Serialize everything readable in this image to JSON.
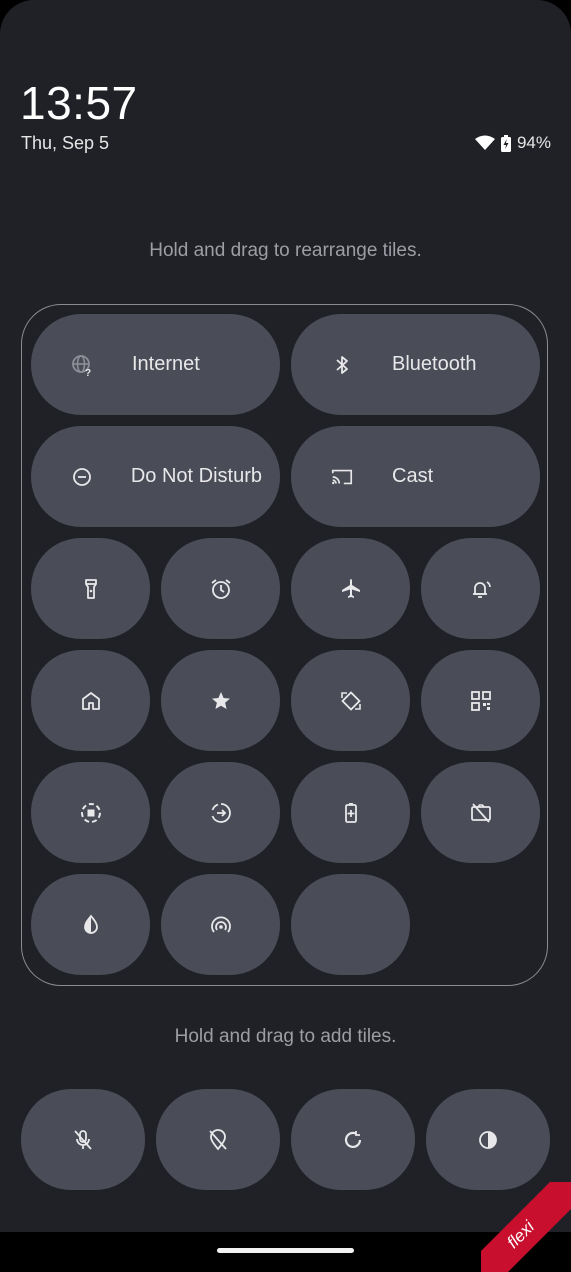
{
  "status_bar": {
    "time": "13:57",
    "date": "Thu, Sep 5",
    "battery": "94%"
  },
  "hints": {
    "rearrange": "Hold and drag to rearrange tiles.",
    "add": "Hold and drag to add tiles."
  },
  "active_tiles": [
    {
      "label": "Internet",
      "icon": "internet-icon"
    },
    {
      "label": "Bluetooth",
      "icon": "bluetooth-icon"
    },
    {
      "label": "Do Not Disturb",
      "icon": "do-not-disturb-icon"
    },
    {
      "label": "Cast",
      "icon": "cast-icon"
    },
    {
      "icon": "flashlight-icon"
    },
    {
      "icon": "alarm-icon"
    },
    {
      "icon": "airplane-icon"
    },
    {
      "icon": "sound-ring-icon"
    },
    {
      "icon": "home-icon"
    },
    {
      "icon": "star-icon"
    },
    {
      "icon": "auto-rotate-icon"
    },
    {
      "icon": "qr-code-scanner-icon"
    },
    {
      "icon": "screen-record-icon"
    },
    {
      "icon": "data-saver-icon"
    },
    {
      "icon": "battery-saver-icon"
    },
    {
      "icon": "camera-off-icon"
    },
    {
      "icon": "color-inversion-icon"
    },
    {
      "icon": "hotspot-icon"
    },
    {
      "icon": ""
    }
  ],
  "available_tiles": [
    {
      "icon": "mic-off-icon"
    },
    {
      "icon": "location-off-icon"
    },
    {
      "icon": "sync-icon"
    },
    {
      "icon": "contrast-icon"
    }
  ],
  "watermark": "flexi",
  "colors": {
    "background": "#1f2126",
    "tile": "#4a4c58",
    "text": "#e8e8ea",
    "hint": "#9c9ea4"
  }
}
